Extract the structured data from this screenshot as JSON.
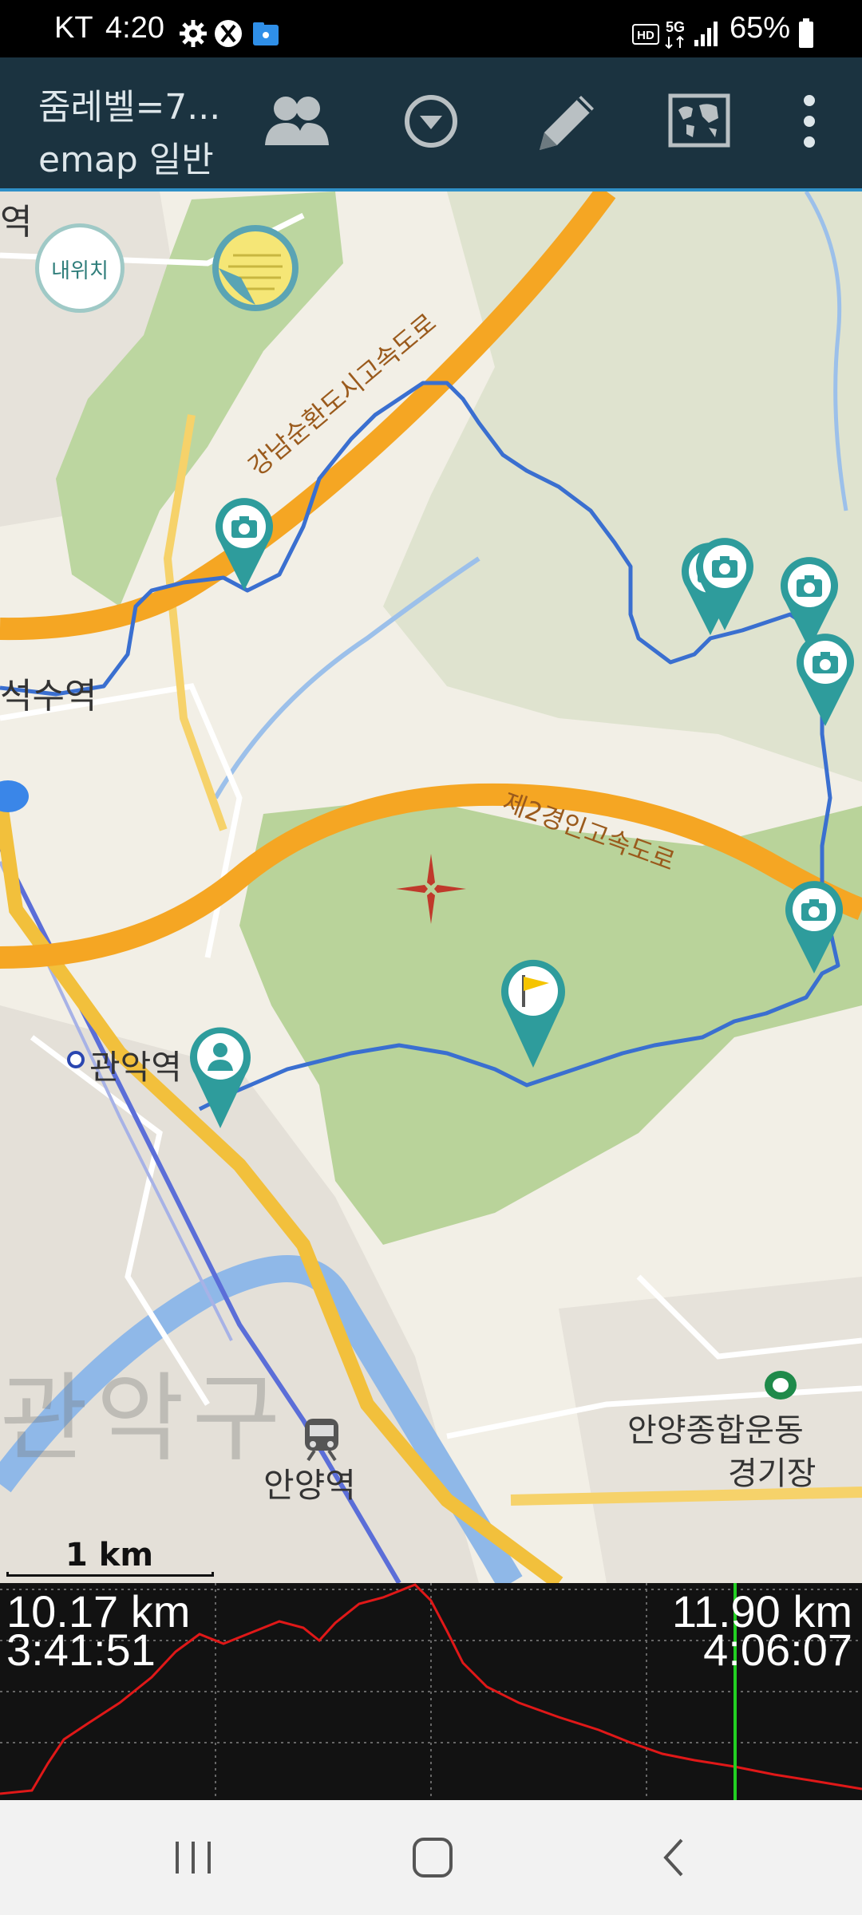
{
  "status_bar": {
    "carrier": "KT",
    "time": "4:20",
    "network": "5G",
    "battery": "65%"
  },
  "toolbar": {
    "zoom_level": "줌레벨=7...",
    "map_type": "emap 일반",
    "icons": [
      "group-icon",
      "dropdown-circle-icon",
      "pencil-icon",
      "world-map-icon",
      "more-vert-icon"
    ]
  },
  "map": {
    "my_location_label": "내위치",
    "expressway_1": "강남순환도시고속도로",
    "expressway_2": "제2경인고속도로",
    "station_1": "관악역",
    "station_2": "안양역",
    "station_3_partial": "석수역",
    "district": "관악구",
    "stadium_line1": "안양종합운동",
    "stadium_line2": "경기장",
    "top_left_partial": "역",
    "scale": "1 km",
    "markers": [
      "camera-icon",
      "camera-icon",
      "camera-icon",
      "camera-icon",
      "camera-icon",
      "camera-icon",
      "flag-icon",
      "person-icon"
    ],
    "colors": {
      "track": "#3a6fd0",
      "marker": "#2e9c9c",
      "road": "#f5a623",
      "forest": "#b9d39a"
    }
  },
  "elevation": {
    "left_distance": "10.17 km",
    "left_time": "3:41:51",
    "right_distance": "11.90 km",
    "right_time": "4:06:07",
    "cursor_fraction": 0.853
  },
  "navbar": {
    "icons": [
      "recent-apps-icon",
      "home-icon",
      "back-icon"
    ]
  }
}
